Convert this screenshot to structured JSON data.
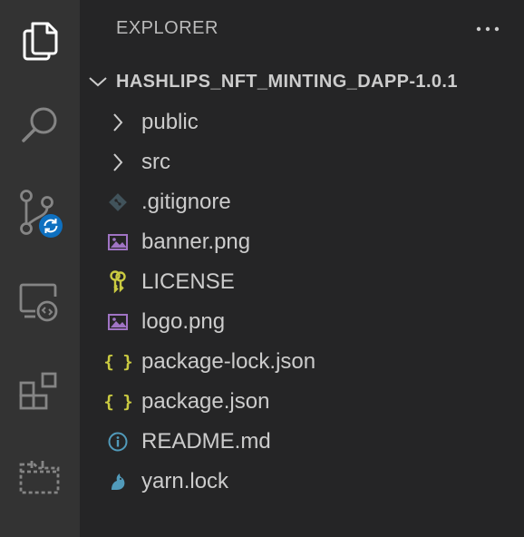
{
  "activity_bar": {
    "items": [
      {
        "icon": "explorer-icon",
        "active": true
      },
      {
        "icon": "search-icon",
        "active": false
      },
      {
        "icon": "source-control-icon",
        "active": false
      },
      {
        "icon": "remote-explorer-icon",
        "active": false
      },
      {
        "icon": "extensions-icon",
        "active": false
      },
      {
        "icon": "project-manager-icon",
        "active": false
      }
    ]
  },
  "sidebar": {
    "title": "EXPLORER",
    "more_icon": "ellipsis-icon"
  },
  "folder": {
    "name": "HASHLIPS_NFT_MINTING_DAPP-1.0.1",
    "expanded": true
  },
  "tree": {
    "items": [
      {
        "label": "public",
        "type": "folder",
        "icon": "chevron-right-icon"
      },
      {
        "label": "src",
        "type": "folder",
        "icon": "chevron-right-icon"
      },
      {
        "label": ".gitignore",
        "type": "file",
        "icon": "git-icon"
      },
      {
        "label": "banner.png",
        "type": "file",
        "icon": "image-icon"
      },
      {
        "label": "LICENSE",
        "type": "file",
        "icon": "license-key-icon"
      },
      {
        "label": "logo.png",
        "type": "file",
        "icon": "image-icon"
      },
      {
        "label": "package-lock.json",
        "type": "file",
        "icon": "json-icon"
      },
      {
        "label": "package.json",
        "type": "file",
        "icon": "json-icon"
      },
      {
        "label": "README.md",
        "type": "file",
        "icon": "info-icon"
      },
      {
        "label": "yarn.lock",
        "type": "file",
        "icon": "yarn-icon"
      }
    ]
  },
  "colors": {
    "activity_bar_bg": "#333333",
    "sidebar_bg": "#252526",
    "text": "#cccccc",
    "json_brace": "#cbcb41",
    "image_icon": "#a074c4",
    "info_icon": "#519aba",
    "license_icon": "#cbcb41",
    "git_icon": "#41535b",
    "yarn_icon": "#519aba",
    "badge": "#0e70c0"
  }
}
